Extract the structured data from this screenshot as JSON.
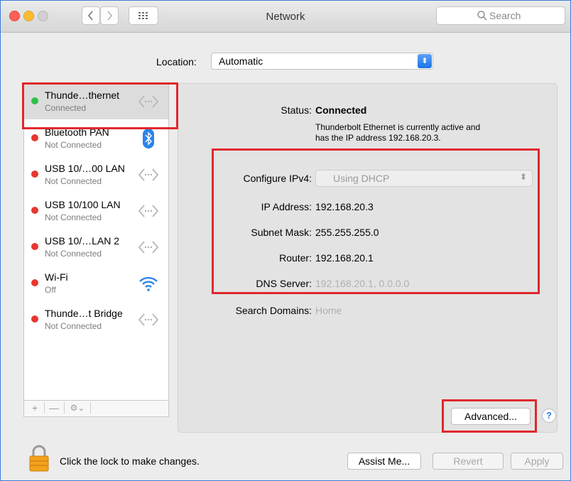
{
  "window": {
    "title": "Network",
    "search_placeholder": "Search",
    "back_icon": "chevron-left-icon",
    "forward_icon": "chevron-right-icon",
    "grid_icon": "grid-icon"
  },
  "location": {
    "label": "Location:",
    "value": "Automatic"
  },
  "services": [
    {
      "name": "Thunde…thernet",
      "status": "Connected",
      "dot": "#2fc24a",
      "icon": "ethernet-arrows-icon"
    },
    {
      "name": "Bluetooth PAN",
      "status": "Not Connected",
      "dot": "#e8362f",
      "icon": "bluetooth-icon"
    },
    {
      "name": "USB 10/…00 LAN",
      "status": "Not Connected",
      "dot": "#e8362f",
      "icon": "ethernet-arrows-icon"
    },
    {
      "name": "USB 10/100 LAN",
      "status": "Not Connected",
      "dot": "#e8362f",
      "icon": "ethernet-arrows-icon"
    },
    {
      "name": "USB 10/…LAN 2",
      "status": "Not Connected",
      "dot": "#e8362f",
      "icon": "ethernet-arrows-icon"
    },
    {
      "name": "Wi-Fi",
      "status": "Off",
      "dot": "#e8362f",
      "icon": "wifi-icon"
    },
    {
      "name": "Thunde…t Bridge",
      "status": "Not Connected",
      "dot": "#e8362f",
      "icon": "ethernet-arrows-icon"
    }
  ],
  "sidebar_controls": {
    "add": "+",
    "remove": "—",
    "gear": "⚙⌄"
  },
  "detail": {
    "status_label": "Status:",
    "status_value": "Connected",
    "status_desc_1": "Thunderbolt Ethernet is currently active and",
    "status_desc_2": "has the IP address 192.168.20.3.",
    "configure_label": "Configure IPv4:",
    "configure_value": "Using DHCP",
    "ip_label": "IP Address:",
    "ip_value": "192.168.20.3",
    "subnet_label": "Subnet Mask:",
    "subnet_value": "255.255.255.0",
    "router_label": "Router:",
    "router_value": "192.168.20.1",
    "dns_label": "DNS Server:",
    "dns_value": "192.168.20.1, 0.0.0.0",
    "domains_label": "Search Domains:",
    "domains_value": "Home",
    "advanced": "Advanced...",
    "help": "?"
  },
  "footer": {
    "lock_text": "Click the lock to make changes.",
    "assist": "Assist Me...",
    "revert": "Revert",
    "apply": "Apply"
  },
  "colors": {
    "highlight_box": "#e0282e",
    "connected": "#2fc24a",
    "not_connected": "#e8362f",
    "accent": "#1b72e8"
  }
}
